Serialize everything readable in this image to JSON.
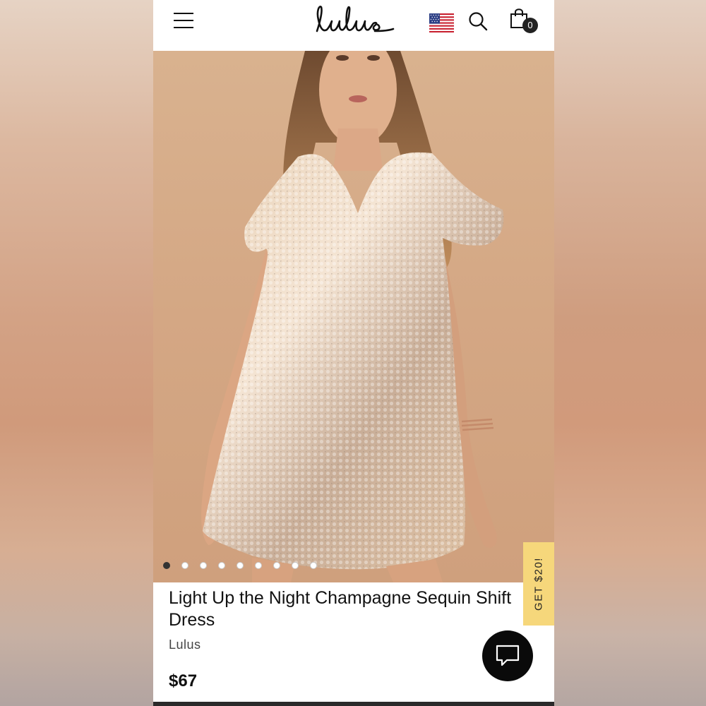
{
  "header": {
    "logo_text": "Lulus",
    "cart_count": "0",
    "icons": [
      "menu-icon",
      "us-flag-icon",
      "search-icon",
      "shopping-bag-icon"
    ]
  },
  "gallery": {
    "image_count": 9,
    "active_index": 0
  },
  "promo": {
    "label": "GET $20!",
    "color": "#f6d77b"
  },
  "product": {
    "title": "Light Up the Night Champagne Sequin Shift Dress",
    "brand": "Lulus",
    "price": "$67"
  },
  "chat": {
    "icon": "chat-bubble-icon"
  }
}
